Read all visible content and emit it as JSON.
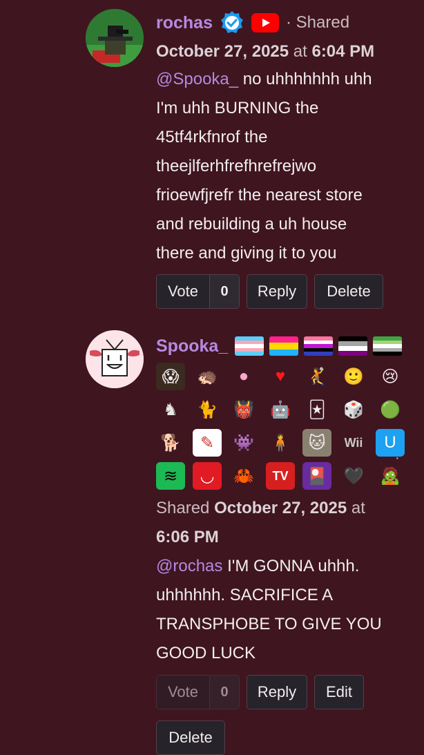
{
  "comments": [
    {
      "username": "rochas",
      "shared_label": "· Shared",
      "date": "October 27, 2025",
      "at": "at",
      "time": "6:04 PM",
      "mention": "@Spooka_",
      "lines": [
        "no uhhhhhhh uhh",
        "I'm uhh BURNING the",
        "45tf4rkfnrof the",
        "theejlferhfrefhrefrejwo",
        "frioewfjrefr the nearest store",
        "and rebuilding a uh house",
        "there and giving it to you"
      ],
      "vote_label": "Vote",
      "vote_count": "0",
      "reply_label": "Reply",
      "delete_label": "Delete",
      "icons": [
        "verified-icon",
        "youtube-icon"
      ]
    },
    {
      "username": "Spooka_",
      "shared_label": "Shared",
      "date": "October 27, 2025",
      "at": "at",
      "time": "6:06 PM",
      "dot": "·",
      "mention": "@rochas",
      "lines": [
        "I'M GONNA uhhh.",
        "uhhhhhh. SACRIFICE A",
        "TRANSPHOBE TO GIVE YOU",
        "GOOD LUCK"
      ],
      "vote_label": "Vote",
      "vote_count": "0",
      "reply_label": "Reply",
      "edit_label": "Edit",
      "delete_label": "Delete",
      "flags": [
        {
          "name": "trans-flag",
          "colors": [
            "#5bcefa",
            "#f5a9b8",
            "#ffffff",
            "#f5a9b8",
            "#5bcefa"
          ]
        },
        {
          "name": "pan-flag",
          "colors": [
            "#ff218c",
            "#ffd800",
            "#21b1ff"
          ]
        },
        {
          "name": "genderfluid-flag",
          "colors": [
            "#ff75a2",
            "#ffffff",
            "#be18d6",
            "#000000",
            "#333ebd"
          ]
        },
        {
          "name": "asexual-flag",
          "colors": [
            "#000000",
            "#a3a3a3",
            "#ffffff",
            "#800080"
          ]
        },
        {
          "name": "aromantic-flag",
          "colors": [
            "#3da542",
            "#a7d379",
            "#ffffff",
            "#a9a9a9",
            "#000000"
          ]
        }
      ],
      "badges": [
        {
          "name": "pizza-tower-icon",
          "glyph": "😱",
          "bg": "#3a2a20"
        },
        {
          "name": "sonic-icon",
          "glyph": "🦔",
          "bg": "transparent"
        },
        {
          "name": "kirby-icon",
          "glyph": "●",
          "bg": "transparent",
          "color": "#f7a8c8"
        },
        {
          "name": "undertale-heart-icon",
          "glyph": "♥",
          "bg": "transparent",
          "color": "#ff1a1a"
        },
        {
          "name": "rayman-icon",
          "glyph": "🤾",
          "bg": "transparent"
        },
        {
          "name": "roblox-noob-icon",
          "glyph": "🙂",
          "bg": "transparent"
        },
        {
          "name": "isaac-icon",
          "glyph": "😢",
          "bg": "transparent"
        },
        {
          "name": "hollow-knight-icon",
          "glyph": "♞",
          "bg": "transparent",
          "color": "#e8e8e8"
        },
        {
          "name": "ghost-cat-icon",
          "glyph": "🐈",
          "bg": "transparent"
        },
        {
          "name": "monster-icon",
          "glyph": "👹",
          "bg": "transparent"
        },
        {
          "name": "astro-bot-icon",
          "glyph": "🤖",
          "bg": "transparent"
        },
        {
          "name": "jester-icon",
          "glyph": "🃏",
          "bg": "transparent"
        },
        {
          "name": "dice-icon",
          "glyph": "🎲",
          "bg": "transparent"
        },
        {
          "name": "green-orb-icon",
          "glyph": "🟢",
          "bg": "transparent"
        },
        {
          "name": "annoying-dog-icon",
          "glyph": "🐕",
          "bg": "transparent"
        },
        {
          "name": "doodle-icon",
          "glyph": "✎",
          "bg": "#ffffff",
          "color": "#c33"
        },
        {
          "name": "deltarune-susie-icon",
          "glyph": "👾",
          "bg": "transparent"
        },
        {
          "name": "kris-icon",
          "glyph": "🧍",
          "bg": "transparent"
        },
        {
          "name": "cat-photo-icon",
          "glyph": "🐱",
          "bg": "#8a8070"
        },
        {
          "name": "wii-logo-icon",
          "glyph": "Wii",
          "bg": "transparent",
          "color": "#c8c8c8"
        },
        {
          "name": "wii-u-logo-icon",
          "glyph": "U",
          "bg": "#1da1f2",
          "color": "#ffffff"
        },
        {
          "name": "spotify-icon",
          "glyph": "≋",
          "bg": "#1db954",
          "color": "#000000"
        },
        {
          "name": "red-smile-icon",
          "glyph": "◡",
          "bg": "#e01b24",
          "color": "#ffffff"
        },
        {
          "name": "crab-icon",
          "glyph": "🦀",
          "bg": "transparent"
        },
        {
          "name": "as-seen-on-tv-icon",
          "glyph": "TV",
          "bg": "#d61f1f",
          "color": "#ffffff"
        },
        {
          "name": "purple-card-icon",
          "glyph": "🎴",
          "bg": "#6a2aa0"
        },
        {
          "name": "heart-face-icon",
          "glyph": "🖤",
          "bg": "transparent"
        },
        {
          "name": "green-creature-icon",
          "glyph": "🧟",
          "bg": "transparent"
        }
      ]
    }
  ]
}
